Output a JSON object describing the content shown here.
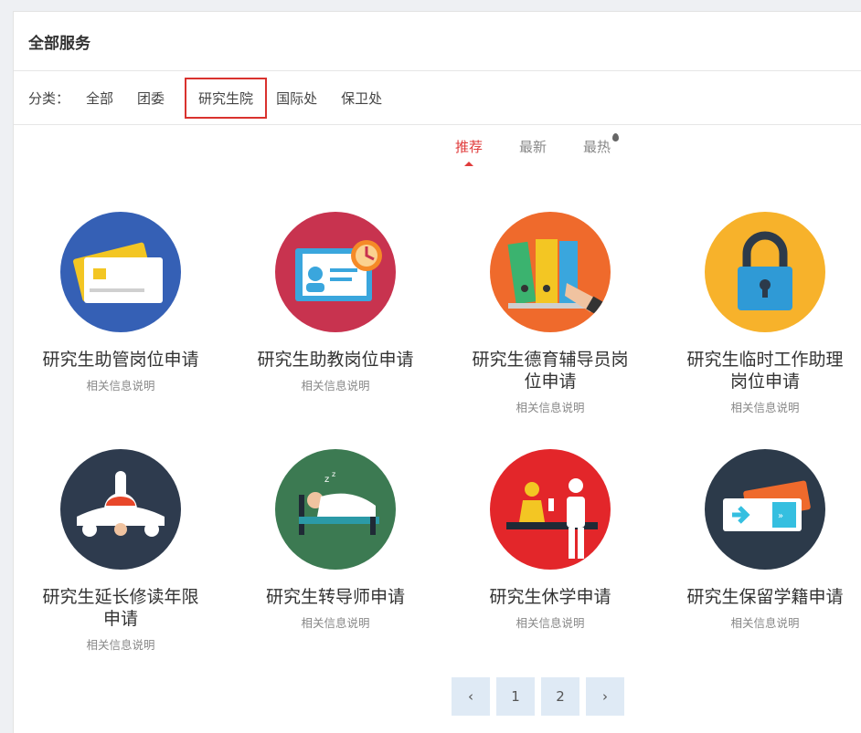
{
  "header": {
    "title": "全部服务"
  },
  "categories": {
    "label": "分类：",
    "items": [
      "全部",
      "团委",
      "研究生院",
      "国际处",
      "保卫处"
    ],
    "active": "研究生院"
  },
  "sort_tabs": [
    {
      "label": "推荐",
      "active": true
    },
    {
      "label": "最新",
      "active": false
    },
    {
      "label": "最热",
      "active": false
    }
  ],
  "services": [
    {
      "title": "研究生助管岗位申请",
      "desc": "相关信息说明",
      "icon": "id-card-icon",
      "color": "#3560b5"
    },
    {
      "title": "研究生助教岗位申请",
      "desc": "相关信息说明",
      "icon": "badge-clock-icon",
      "color": "#c8334f"
    },
    {
      "title": "研究生德育辅导员岗位申请",
      "desc": "相关信息说明",
      "icon": "folders-icon",
      "color": "#ef6a2c"
    },
    {
      "title": "研究生临时工作助理岗位申请",
      "desc": "相关信息说明",
      "icon": "padlock-icon",
      "color": "#f7b22b"
    },
    {
      "title": "研究生延长修读年限申请",
      "desc": "相关信息说明",
      "icon": "airplane-icon",
      "color": "#2e3b4e"
    },
    {
      "title": "研究生转导师申请",
      "desc": "相关信息说明",
      "icon": "sleeping-bed-icon",
      "color": "#3c7a52"
    },
    {
      "title": "研究生休学申请",
      "desc": "相关信息说明",
      "icon": "reception-desk-icon",
      "color": "#e3262a"
    },
    {
      "title": "研究生保留学籍申请",
      "desc": "相关信息说明",
      "icon": "ticket-icon",
      "color": "#2c3a4a"
    }
  ],
  "pagination": {
    "prev": "‹",
    "pages": [
      "1",
      "2"
    ],
    "next": "›"
  }
}
